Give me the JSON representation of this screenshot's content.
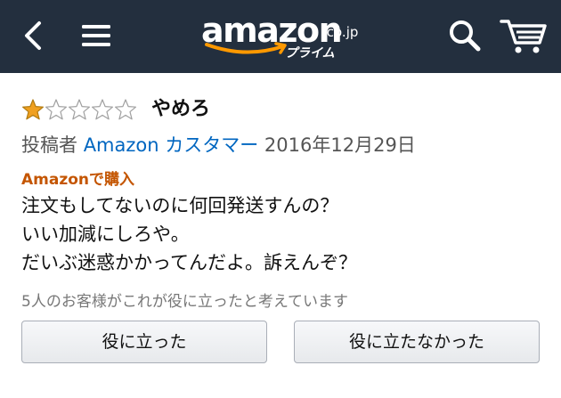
{
  "header": {
    "logo_text": "amazon",
    "logo_domain": ".co.jp",
    "logo_sub": "プライム",
    "icons": {
      "back": "chevron-left-icon",
      "menu": "hamburger-menu-icon",
      "search": "search-icon",
      "cart": "cart-icon"
    },
    "colors": {
      "bar": "#232f3e",
      "smile": "#f90"
    }
  },
  "review": {
    "rating": 1,
    "rating_max": 5,
    "title": "やめろ",
    "byline_prefix": "投稿者",
    "author": "Amazon カスタマー",
    "date": "2016年12月29日",
    "verified": "Amazonで購入",
    "body_lines": [
      "注文もしてないのに何回発送すんの？",
      "いい加減にしろや。",
      "だいぶ迷惑かかってんだよ。訴えんぞ？"
    ],
    "helpful_count_text": "5人のお客様がこれが役に立ったと考えています",
    "buttons": {
      "helpful": "役に立った",
      "not_helpful": "役に立たなかった"
    },
    "colors": {
      "star": "#f0a020",
      "link": "#0066c0",
      "verified": "#c45500"
    }
  }
}
